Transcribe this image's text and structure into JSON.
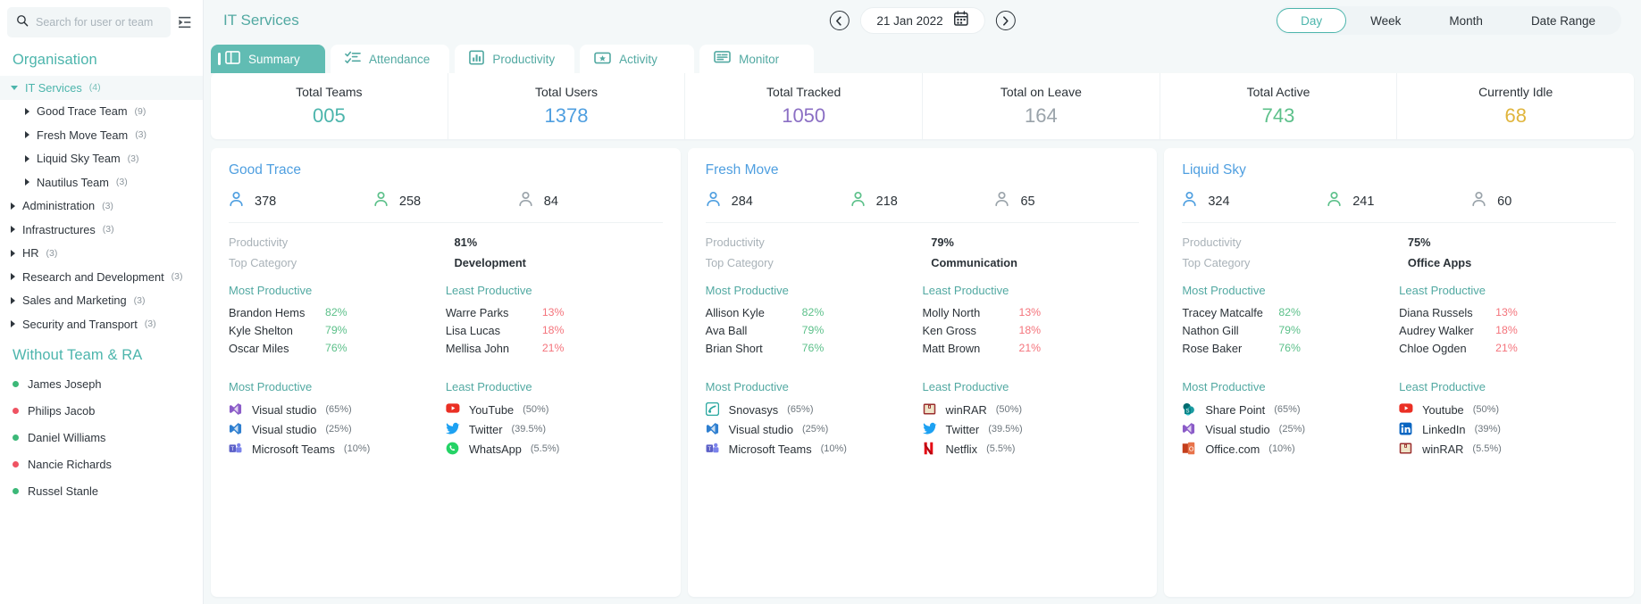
{
  "colors": {
    "teal": "#4cb5ac",
    "blue": "#4f9fe0",
    "purple": "#8b6fc4",
    "green": "#5cc08a",
    "gray": "#9aa3aa",
    "yellow": "#e0b53c",
    "red": "#f4737b"
  },
  "sidebar": {
    "search": {
      "placeholder": "Search for user or team",
      "value": ""
    },
    "search_icon": "search-icon",
    "collapse_icon": "collapse-panel-icon",
    "section_organisation": "Organisation",
    "section_without_team": "Without Team & RA",
    "tree": [
      {
        "label": "IT Services",
        "count": "(4)",
        "level": 0,
        "active": true,
        "expanded": true
      },
      {
        "label": "Good Trace Team",
        "count": "(9)",
        "level": 1,
        "active": false,
        "expanded": false
      },
      {
        "label": "Fresh Move Team",
        "count": "(3)",
        "level": 1,
        "active": false,
        "expanded": false
      },
      {
        "label": "Liquid Sky Team",
        "count": "(3)",
        "level": 1,
        "active": false,
        "expanded": false
      },
      {
        "label": "Nautilus Team",
        "count": "(3)",
        "level": 1,
        "active": false,
        "expanded": false
      },
      {
        "label": "Administration",
        "count": "(3)",
        "level": 0,
        "active": false,
        "expanded": false
      },
      {
        "label": "Infrastructures",
        "count": "(3)",
        "level": 0,
        "active": false,
        "expanded": false
      },
      {
        "label": "HR",
        "count": "(3)",
        "level": 0,
        "active": false,
        "expanded": false
      },
      {
        "label": "Research and Development",
        "count": "(3)",
        "level": 0,
        "active": false,
        "expanded": false
      },
      {
        "label": "Sales and Marketing",
        "count": "(3)",
        "level": 0,
        "active": false,
        "expanded": false
      },
      {
        "label": "Security and Transport",
        "count": "(3)",
        "level": 0,
        "active": false,
        "expanded": false
      }
    ],
    "users": [
      {
        "name": "James Joseph",
        "status": "online",
        "color": "#3cb878"
      },
      {
        "name": "Philips Jacob",
        "status": "offline",
        "color": "#ef5362"
      },
      {
        "name": "Daniel Williams",
        "status": "online",
        "color": "#3cb878"
      },
      {
        "name": "Nancie Richards",
        "status": "offline",
        "color": "#ef5362"
      },
      {
        "name": "Russel Stanle",
        "status": "online",
        "color": "#3cb878"
      }
    ]
  },
  "header": {
    "title": "IT Services",
    "date": "21 Jan 2022",
    "prev_icon": "chevron-left-circle-icon",
    "next_icon": "chevron-right-circle-icon",
    "calendar_icon": "calendar-icon",
    "modes": [
      {
        "label": "Day",
        "active": true
      },
      {
        "label": "Week",
        "active": false
      },
      {
        "label": "Month",
        "active": false
      },
      {
        "label": "Date Range",
        "active": false
      }
    ]
  },
  "tabs": [
    {
      "label": "Summary",
      "icon": "summary-panel-icon",
      "active": true
    },
    {
      "label": "Attendance",
      "icon": "checklist-icon",
      "active": false
    },
    {
      "label": "Productivity",
      "icon": "bar-chart-icon",
      "active": false
    },
    {
      "label": "Activity",
      "icon": "ticket-star-icon",
      "active": false
    },
    {
      "label": "Monitor",
      "icon": "monitor-screen-icon",
      "active": false
    }
  ],
  "kpis": [
    {
      "label": "Total Teams",
      "value": "005",
      "color": "#4cb5ac"
    },
    {
      "label": "Total Users",
      "value": "1378",
      "color": "#4f9fe0"
    },
    {
      "label": "Total Tracked",
      "value": "1050",
      "color": "#8b6fc4"
    },
    {
      "label": "Total on Leave",
      "value": "164",
      "color": "#9aa3aa"
    },
    {
      "label": "Total Active",
      "value": "743",
      "color": "#5cc08a"
    },
    {
      "label": "Currently Idle",
      "value": "68",
      "color": "#e0b53c"
    }
  ],
  "labels": {
    "productivity": "Productivity",
    "top_category": "Top Category",
    "most_productive": "Most Productive",
    "least_productive": "Least Productive"
  },
  "cards": [
    {
      "title": "Good Trace",
      "title_color": "#4f9fe0",
      "counts": [
        {
          "value": "378",
          "icon": "user-icon",
          "color": "#4f9fe0"
        },
        {
          "value": "258",
          "icon": "user-icon",
          "color": "#5cc08a"
        },
        {
          "value": "84",
          "icon": "user-icon",
          "color": "#9aa3aa"
        }
      ],
      "productivity": "81%",
      "top_category": "Development",
      "most_productive_people": [
        {
          "name": "Brandon Hems",
          "pct": "82%"
        },
        {
          "name": "Kyle Shelton",
          "pct": "79%"
        },
        {
          "name": "Oscar Miles",
          "pct": "76%"
        }
      ],
      "least_productive_people": [
        {
          "name": "Warre Parks",
          "pct": "13%"
        },
        {
          "name": "Lisa Lucas",
          "pct": "18%"
        },
        {
          "name": "Mellisa John",
          "pct": "21%"
        }
      ],
      "most_productive_apps": [
        {
          "name": "Visual studio",
          "pct": "(65%)",
          "icon": "visual-studio-icon",
          "color": "#8b5cc8"
        },
        {
          "name": "Visual studio",
          "pct": "(25%)",
          "icon": "visual-studio-icon",
          "color": "#2f7fd0"
        },
        {
          "name": "Microsoft Teams",
          "pct": "(10%)",
          "icon": "microsoft-teams-icon",
          "color": "#5b5fc7"
        }
      ],
      "least_productive_apps": [
        {
          "name": "YouTube",
          "pct": "(50%)",
          "icon": "youtube-icon",
          "color": "#ea2f24"
        },
        {
          "name": "Twitter",
          "pct": "(39.5%)",
          "icon": "twitter-icon",
          "color": "#1da1f2"
        },
        {
          "name": "WhatsApp",
          "pct": "(5.5%)",
          "icon": "whatsapp-icon",
          "color": "#25d366"
        }
      ]
    },
    {
      "title": "Fresh Move",
      "title_color": "#4f9fe0",
      "counts": [
        {
          "value": "284",
          "icon": "user-icon",
          "color": "#4f9fe0"
        },
        {
          "value": "218",
          "icon": "user-icon",
          "color": "#5cc08a"
        },
        {
          "value": "65",
          "icon": "user-icon",
          "color": "#9aa3aa"
        }
      ],
      "productivity": "79%",
      "top_category": "Communication",
      "most_productive_people": [
        {
          "name": "Allison Kyle",
          "pct": "82%"
        },
        {
          "name": "Ava Ball",
          "pct": "79%"
        },
        {
          "name": "Brian Short",
          "pct": "76%"
        }
      ],
      "least_productive_people": [
        {
          "name": "Molly North",
          "pct": "13%"
        },
        {
          "name": "Ken Gross",
          "pct": "18%"
        },
        {
          "name": "Matt Brown",
          "pct": "21%"
        }
      ],
      "most_productive_apps": [
        {
          "name": "Snovasys",
          "pct": "(65%)",
          "icon": "snovasys-icon",
          "color": "#2aa8a0"
        },
        {
          "name": "Visual studio",
          "pct": "(25%)",
          "icon": "visual-studio-icon",
          "color": "#2f7fd0"
        },
        {
          "name": "Microsoft Teams",
          "pct": "(10%)",
          "icon": "microsoft-teams-icon",
          "color": "#5b5fc7"
        }
      ],
      "least_productive_apps": [
        {
          "name": "winRAR",
          "pct": "(50%)",
          "icon": "winrar-icon",
          "color": "#9b2f2f"
        },
        {
          "name": "Twitter",
          "pct": "(39.5%)",
          "icon": "twitter-icon",
          "color": "#1da1f2"
        },
        {
          "name": "Netflix",
          "pct": "(5.5%)",
          "icon": "netflix-icon",
          "color": "#e50914"
        }
      ]
    },
    {
      "title": "Liquid Sky",
      "title_color": "#4f9fe0",
      "counts": [
        {
          "value": "324",
          "icon": "user-icon",
          "color": "#4f9fe0"
        },
        {
          "value": "241",
          "icon": "user-icon",
          "color": "#5cc08a"
        },
        {
          "value": "60",
          "icon": "user-icon",
          "color": "#9aa3aa"
        }
      ],
      "productivity": "75%",
      "top_category": "Office Apps",
      "most_productive_people": [
        {
          "name": "Tracey Matcalfe",
          "pct": "82%"
        },
        {
          "name": "Nathon Gill",
          "pct": "79%"
        },
        {
          "name": "Rose Baker",
          "pct": "76%"
        }
      ],
      "least_productive_people": [
        {
          "name": "Diana Russels",
          "pct": "13%"
        },
        {
          "name": "Audrey Walker",
          "pct": "18%"
        },
        {
          "name": "Chloe Ogden",
          "pct": "21%"
        }
      ],
      "most_productive_apps": [
        {
          "name": "Share Point",
          "pct": "(65%)",
          "icon": "sharepoint-icon",
          "color": "#038387"
        },
        {
          "name": "Visual studio",
          "pct": "(25%)",
          "icon": "visual-studio-icon",
          "color": "#8b5cc8"
        },
        {
          "name": "Office.com",
          "pct": "(10%)",
          "icon": "office-icon",
          "color": "#d83b01"
        }
      ],
      "least_productive_apps": [
        {
          "name": "Youtube",
          "pct": "(50%)",
          "icon": "youtube-icon",
          "color": "#ea2f24"
        },
        {
          "name": "LinkedIn",
          "pct": "(39%)",
          "icon": "linkedin-icon",
          "color": "#0a66c2"
        },
        {
          "name": "winRAR",
          "pct": "(5.5%)",
          "icon": "winrar-icon",
          "color": "#9b2f2f"
        }
      ]
    }
  ]
}
